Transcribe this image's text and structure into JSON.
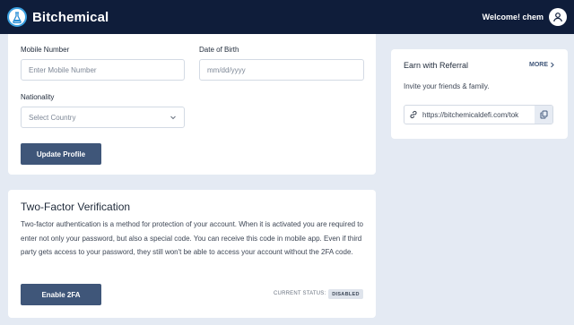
{
  "header": {
    "brand": "Bitchemical",
    "welcome": "Welcome! chem"
  },
  "profile": {
    "mobile_label": "Mobile Number",
    "mobile_placeholder": "Enter Mobile Number",
    "dob_label": "Date of Birth",
    "dob_placeholder": "mm/dd/yyyy",
    "nationality_label": "Nationality",
    "country_value": "Select Country",
    "update_button": "Update Profile"
  },
  "two_factor": {
    "title": "Two-Factor Verification",
    "description": "Two-factor authentication is a method for protection of your account. When it is activated you are required to enter not only your password, but also a special code. You can receive this code in mobile app. Even if third party gets access to your password, they still won't be able to access your account without the 2FA code.",
    "enable_button": "Enable 2FA",
    "status_label": "CURRENT STATUS:",
    "status_value": "DISABLED"
  },
  "referral": {
    "title": "Earn with Referral",
    "more": "MORE",
    "subtitle": "Invite your friends & family.",
    "link": "https://bitchemicaldefi.com/tok"
  },
  "icons": {
    "logo": "flask-logo-icon",
    "avatar": "user-icon",
    "dropdown": "chevron-down-icon",
    "more": "chevron-right-icon",
    "link": "link-icon",
    "copy": "copy-icon"
  },
  "colors": {
    "header_bg": "#0f1d3a",
    "page_bg": "#e4eaf3",
    "button_bg": "#3f5679",
    "badge_bg": "#dfe4ec"
  }
}
